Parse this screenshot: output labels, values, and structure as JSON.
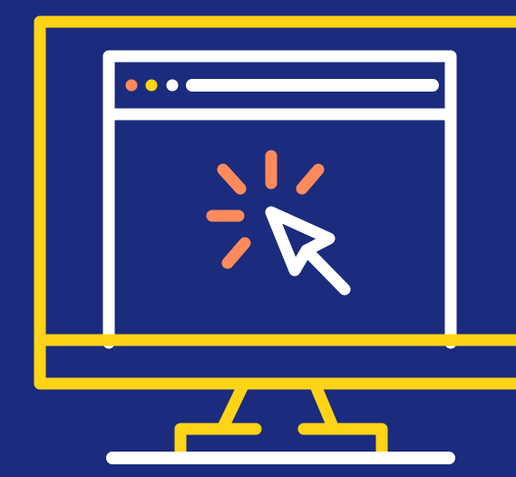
{
  "illustration": {
    "subject": "monitor-with-browser-window-and-click-cursor",
    "icons": {
      "monitor": "monitor-icon",
      "browser_window": "browser-window-icon",
      "cursor": "cursor-arrow-icon",
      "click_burst": "click-burst-icon"
    },
    "window_dots": [
      "red-dot",
      "yellow-dot",
      "white-dot"
    ]
  },
  "colors": {
    "background": "#1b2b7e",
    "monitor_outline": "#ffd316",
    "browser_outline": "#ffffff",
    "cursor": "#ffffff",
    "click_burst": "#ff8a5c",
    "dot_red": "#ff8a5c",
    "dot_yellow": "#ffd316",
    "dot_white": "#ffffff"
  }
}
